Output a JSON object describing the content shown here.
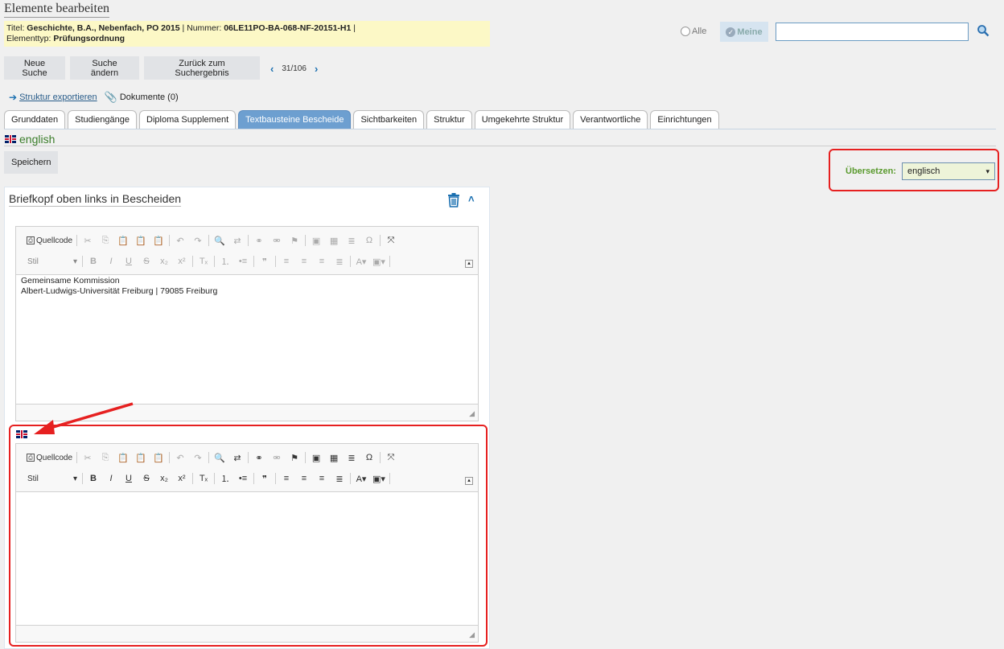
{
  "page": {
    "title": "Elemente bearbeiten"
  },
  "info": {
    "titel_label": "Titel:",
    "titel_value": "Geschichte, B.A., Nebenfach, PO 2015",
    "sep1": " | Nummer: ",
    "nummer_value": "06LE11PO-BA-068-NF-20151-H1",
    "sep2": " |",
    "elementtyp_label": "Elementtyp:",
    "elementtyp_value": "Prüfungsordnung"
  },
  "search": {
    "alle": "Alle",
    "meine": "Meine",
    "value": ""
  },
  "buttons": {
    "neue_suche": "Neue Suche",
    "suche_aendern": "Suche ändern",
    "zurueck": "Zurück zum Suchergebnis",
    "speichern": "Speichern"
  },
  "pager": {
    "position": "31/106"
  },
  "links": {
    "export": "Struktur exportieren",
    "dokumente": "Dokumente (0)"
  },
  "tabs": [
    {
      "label": "Grunddaten"
    },
    {
      "label": "Studiengänge"
    },
    {
      "label": "Diploma Supplement"
    },
    {
      "label": "Textbausteine Bescheide"
    },
    {
      "label": "Sichtbarkeiten"
    },
    {
      "label": "Struktur"
    },
    {
      "label": "Umgekehrte Struktur"
    },
    {
      "label": "Verantwortliche"
    },
    {
      "label": "Einrichtungen"
    }
  ],
  "language": {
    "label": "english"
  },
  "translate": {
    "label": "Übersetzen:",
    "selected": "englisch"
  },
  "section": {
    "title": "Briefkopf oben links in Bescheiden"
  },
  "editor": {
    "source_label": "Quellcode",
    "style_label": "Stil",
    "content_line1": "Gemeinsame Kommission",
    "content_line2": "Albert-Ludwigs-Universität Freiburg | 79085 Freiburg"
  },
  "colors": {
    "accent": "#6d9fd0",
    "highlight": "#e62020",
    "info_bg": "#fcf8c6"
  }
}
